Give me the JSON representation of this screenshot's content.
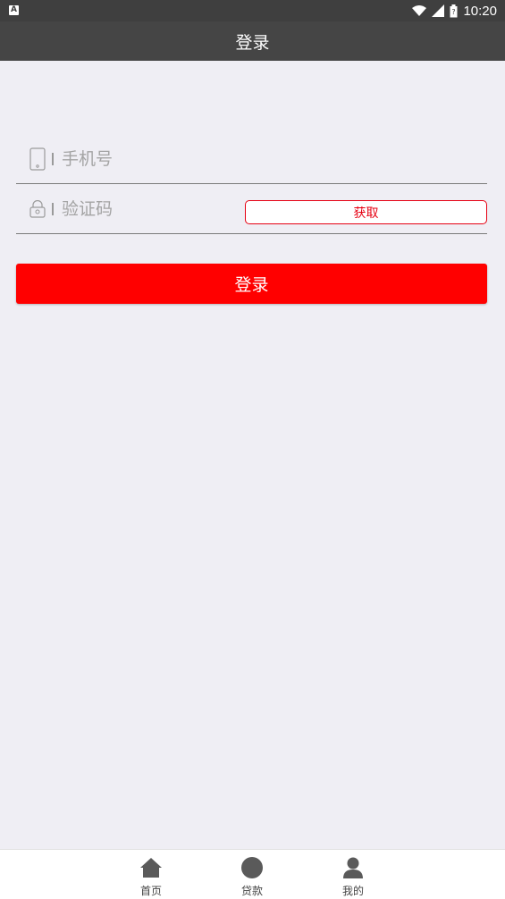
{
  "status_bar": {
    "time": "10:20",
    "left_badge": "A"
  },
  "header": {
    "title": "登录"
  },
  "form": {
    "phone_placeholder": "手机号",
    "code_placeholder": "验证码",
    "get_code_label": "获取"
  },
  "login_button": {
    "label": "登录"
  },
  "tabs": [
    {
      "label": "首页",
      "icon": "home-icon"
    },
    {
      "label": "贷款",
      "icon": "circle-icon"
    },
    {
      "label": "我的",
      "icon": "person-icon"
    }
  ],
  "colors": {
    "accent": "#ff0000",
    "title_bar": "#454545",
    "background": "#efeef4"
  }
}
